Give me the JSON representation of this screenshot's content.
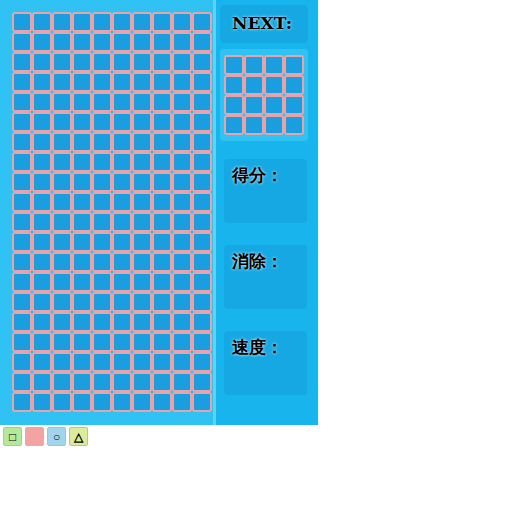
{
  "board": {
    "rows": [
      [
        0,
        0,
        0,
        0,
        0,
        0,
        0,
        0,
        0,
        0
      ],
      [
        0,
        0,
        0,
        0,
        0,
        0,
        0,
        0,
        0,
        0
      ],
      [
        0,
        0,
        0,
        0,
        0,
        0,
        0,
        0,
        0,
        0
      ],
      [
        0,
        0,
        0,
        0,
        0,
        0,
        0,
        0,
        0,
        0
      ],
      [
        0,
        0,
        0,
        0,
        0,
        0,
        0,
        0,
        0,
        0
      ],
      [
        0,
        0,
        0,
        0,
        0,
        0,
        0,
        0,
        0,
        0
      ],
      [
        0,
        0,
        0,
        0,
        0,
        0,
        0,
        0,
        0,
        0
      ],
      [
        0,
        0,
        0,
        0,
        0,
        0,
        0,
        0,
        0,
        0
      ],
      [
        0,
        0,
        0,
        0,
        0,
        0,
        0,
        0,
        0,
        0
      ],
      [
        0,
        0,
        0,
        0,
        0,
        0,
        0,
        0,
        0,
        0
      ],
      [
        0,
        0,
        0,
        0,
        0,
        0,
        0,
        0,
        0,
        0
      ],
      [
        0,
        0,
        0,
        0,
        0,
        0,
        0,
        0,
        0,
        0
      ],
      [
        0,
        0,
        0,
        0,
        0,
        0,
        0,
        0,
        0,
        0
      ],
      [
        0,
        0,
        0,
        0,
        0,
        0,
        0,
        0,
        0,
        0
      ],
      [
        0,
        0,
        0,
        0,
        0,
        0,
        0,
        0,
        0,
        0
      ],
      [
        0,
        0,
        0,
        0,
        0,
        0,
        0,
        0,
        0,
        0
      ],
      [
        0,
        0,
        0,
        0,
        0,
        0,
        0,
        0,
        0,
        0
      ],
      [
        0,
        0,
        0,
        0,
        0,
        0,
        0,
        0,
        0,
        0
      ],
      [
        0,
        0,
        0,
        0,
        0,
        0,
        0,
        0,
        0,
        0
      ],
      [
        0,
        0,
        0,
        0,
        0,
        0,
        0,
        0,
        0,
        0
      ]
    ]
  },
  "next": {
    "label": "NEXT:",
    "rows": [
      [
        0,
        0,
        0,
        0
      ],
      [
        0,
        0,
        0,
        0
      ],
      [
        0,
        0,
        0,
        0
      ],
      [
        0,
        0,
        0,
        0
      ]
    ]
  },
  "stats": [
    {
      "label": "得分："
    },
    {
      "label": "消除："
    },
    {
      "label": "速度："
    }
  ],
  "buttons": [
    {
      "label": "□",
      "color": "#b6e89a"
    },
    {
      "label": "",
      "color": "#f4a3a3"
    },
    {
      "label": "○",
      "color": "#9fd6ee"
    },
    {
      "label": "△",
      "color": "#dcec9c"
    }
  ]
}
